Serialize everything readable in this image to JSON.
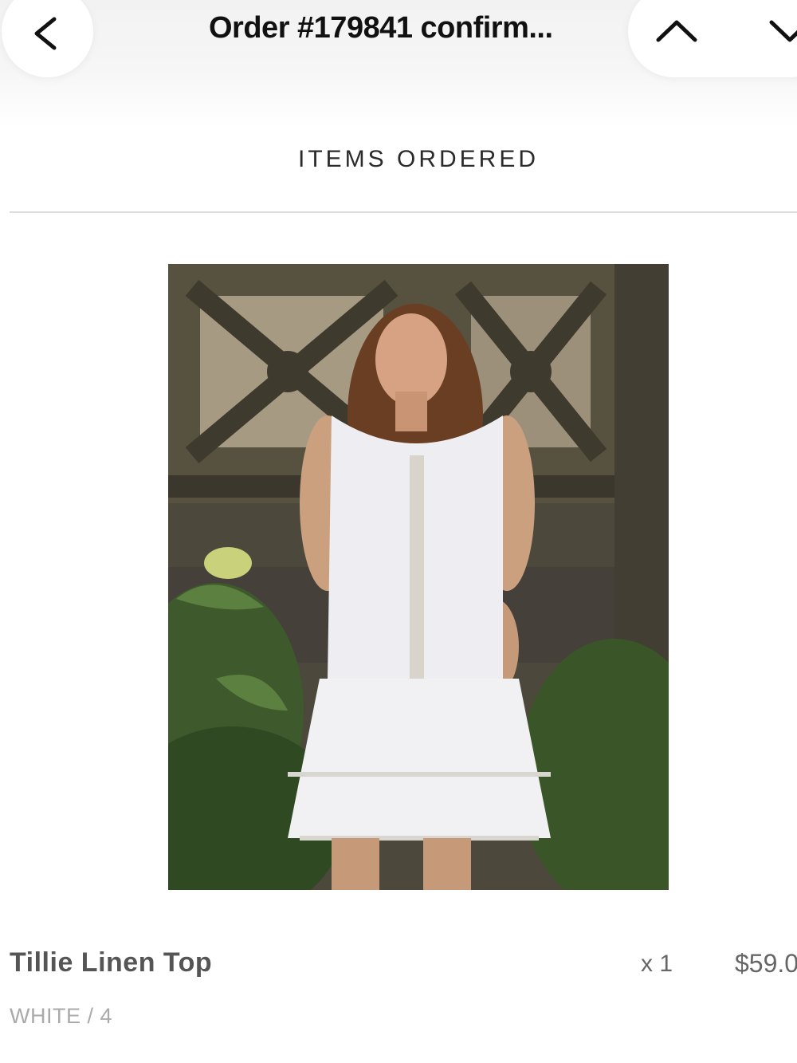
{
  "header": {
    "title": "Order #179841 confirm...",
    "back_icon": "chevron-left-icon",
    "prev_icon": "chevron-up-icon",
    "next_icon": "chevron-down-icon"
  },
  "section": {
    "title": "ITEMS ORDERED"
  },
  "items": [
    {
      "name": "Tillie Linen Top",
      "variant": "WHITE / 4",
      "quantity": "x 1",
      "price": "$59.0"
    }
  ]
}
